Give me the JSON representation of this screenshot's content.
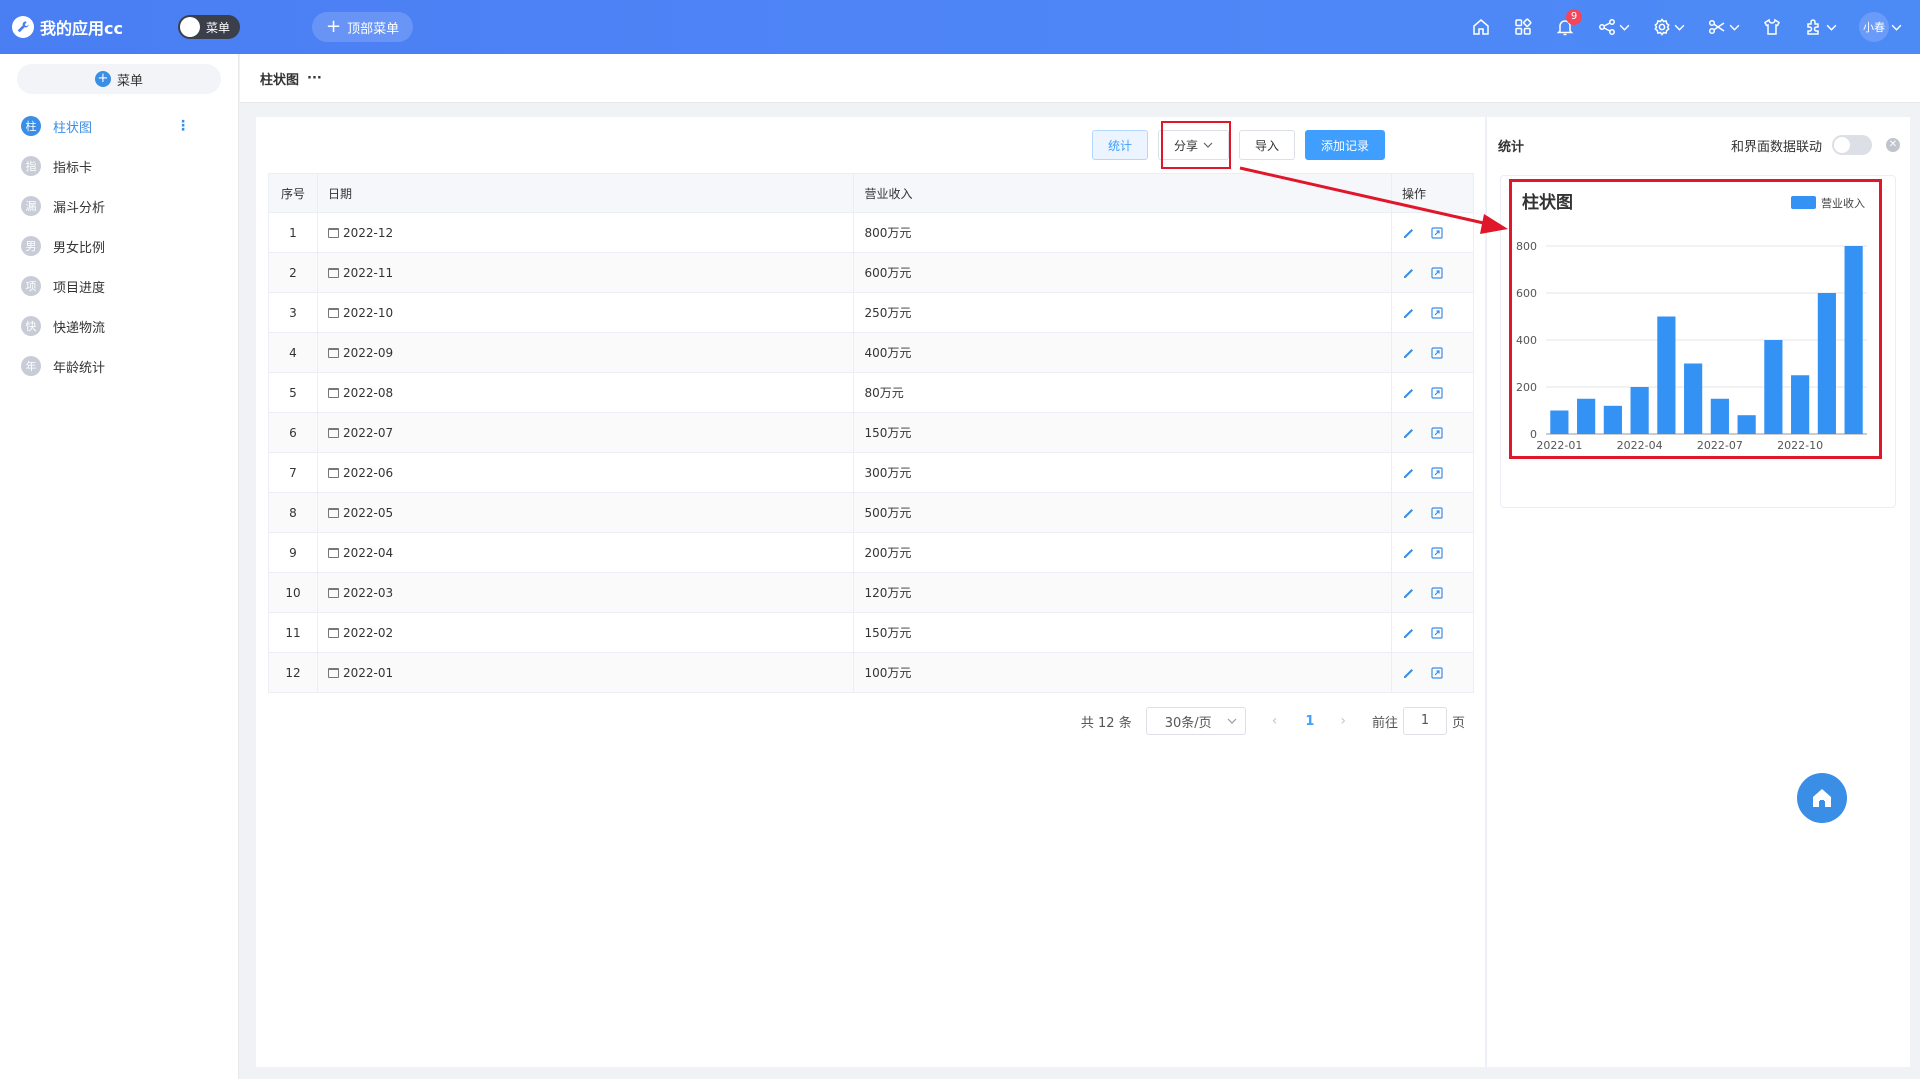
{
  "app": {
    "title": "我的应用cc",
    "menu_toggle_label": "菜单",
    "top_menu_label": "顶部菜单",
    "notification_count": "9",
    "user_name": "小春"
  },
  "sidebar": {
    "menu_button": "菜单",
    "items": [
      {
        "icon_char": "柱",
        "label": "柱状图"
      },
      {
        "icon_char": "指",
        "label": "指标卡"
      },
      {
        "icon_char": "漏",
        "label": "漏斗分析"
      },
      {
        "icon_char": "男",
        "label": "男女比例"
      },
      {
        "icon_char": "项",
        "label": "项目进度"
      },
      {
        "icon_char": "快",
        "label": "快递物流"
      },
      {
        "icon_char": "年",
        "label": "年龄统计"
      }
    ]
  },
  "breadcrumb": {
    "title": "柱状图",
    "more": "···"
  },
  "toolbar": {
    "stat": "统计",
    "share": "分享",
    "import": "导入",
    "add": "添加记录"
  },
  "table": {
    "columns": [
      "序号",
      "日期",
      "营业收入",
      "操作"
    ],
    "rows": [
      {
        "idx": "1",
        "date": "2022-12",
        "revenue": "800万元"
      },
      {
        "idx": "2",
        "date": "2022-11",
        "revenue": "600万元"
      },
      {
        "idx": "3",
        "date": "2022-10",
        "revenue": "250万元"
      },
      {
        "idx": "4",
        "date": "2022-09",
        "revenue": "400万元"
      },
      {
        "idx": "5",
        "date": "2022-08",
        "revenue": "80万元"
      },
      {
        "idx": "6",
        "date": "2022-07",
        "revenue": "150万元"
      },
      {
        "idx": "7",
        "date": "2022-06",
        "revenue": "300万元"
      },
      {
        "idx": "8",
        "date": "2022-05",
        "revenue": "500万元"
      },
      {
        "idx": "9",
        "date": "2022-04",
        "revenue": "200万元"
      },
      {
        "idx": "10",
        "date": "2022-03",
        "revenue": "120万元"
      },
      {
        "idx": "11",
        "date": "2022-02",
        "revenue": "150万元"
      },
      {
        "idx": "12",
        "date": "2022-01",
        "revenue": "100万元"
      }
    ]
  },
  "pager": {
    "total": "共 12 条",
    "page_size": "30条/页",
    "current": "1",
    "goto_label": "前往",
    "goto_value": "1",
    "page_suffix": "页"
  },
  "stat_panel": {
    "title": "统计",
    "link_label": "和界面数据联动"
  },
  "colors": {
    "accent": "#409eff",
    "highlight": "#e0162b",
    "bar": "#3592f5"
  },
  "chart_data": {
    "type": "bar",
    "title": "柱状图",
    "series": [
      {
        "name": "营业收入",
        "values": [
          100,
          150,
          120,
          200,
          500,
          300,
          150,
          80,
          400,
          250,
          600,
          800
        ]
      }
    ],
    "categories": [
      "2022-01",
      "2022-02",
      "2022-03",
      "2022-04",
      "2022-05",
      "2022-06",
      "2022-07",
      "2022-08",
      "2022-09",
      "2022-10",
      "2022-11",
      "2022-12"
    ],
    "x_tick_labels": [
      "2022-01",
      "2022-04",
      "2022-07",
      "2022-10"
    ],
    "y_ticks": [
      0,
      200,
      400,
      600,
      800
    ],
    "ylim": [
      0,
      800
    ],
    "legend": "top-right"
  }
}
